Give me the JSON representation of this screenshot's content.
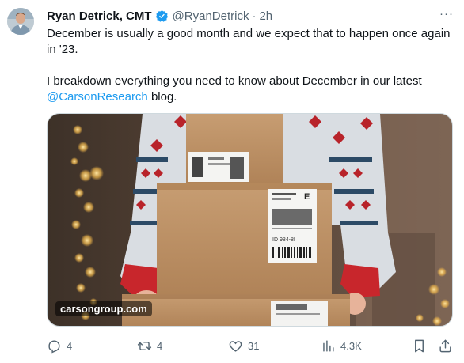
{
  "author": {
    "name": "Ryan Detrick, CMT",
    "handle": "@RyanDetrick",
    "separator": "·",
    "time": "2h"
  },
  "tweet": {
    "line1": "December is usually a good month and we expect that to happen once again in '23.",
    "line2_prefix": "I breakdown everything  you need to know about December in our latest ",
    "mention": "@CarsonResearch",
    "line2_suffix": " blog."
  },
  "media": {
    "watermark": "carsongroup.com",
    "label_id": "ID 984-8I",
    "label_letter": "E"
  },
  "actions": {
    "replies": "4",
    "retweets": "4",
    "likes": "31",
    "views": "4.3K"
  },
  "more_label": "···",
  "colors": {
    "link": "#1d9bf0",
    "verified": "#1d9bf0",
    "muted": "#536471"
  }
}
